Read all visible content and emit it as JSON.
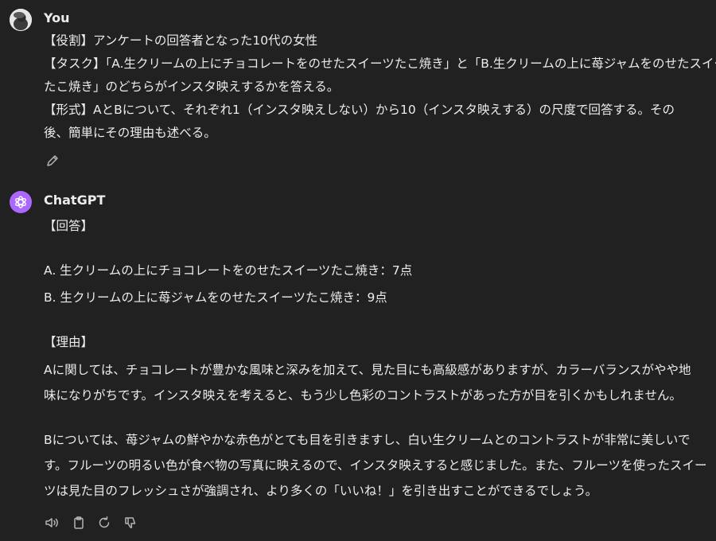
{
  "user": {
    "name": "You",
    "lines": [
      "【役割】アンケートの回答者となった10代の女性",
      "【タスク】「A.生クリームの上にチョコレートをのせたスイーツたこ焼き」と「B.生クリームの上に苺ジャムをのせたスイーツ",
      "たこ焼き」のどちらがインスタ映えするかを答える。",
      "【形式】AとBについて、それぞれ1（インスタ映えしない）から10（インスタ映えする）の尺度で回答する。その",
      "後、簡単にその理由も述べる。"
    ],
    "edit_icon": "pencil-icon"
  },
  "assistant": {
    "name": "ChatGPT",
    "lines": [
      "【回答】",
      "A. 生クリームの上にチョコレートをのせたスイーツたこ焼き：7点",
      "B. 生クリームの上に苺ジャムをのせたスイーツたこ焼き：9点",
      "【理由】",
      "Aに関しては、チョコレートが豊かな風味と深みを加えて、見た目にも高級感がありますが、カラーバランスがやや地",
      "味になりがちです。インスタ映えを考えると、もう少し色彩のコントラストがあった方が目を引くかもしれません。",
      "Bについては、苺ジャムの鮮やかな赤色がとても目を引きますし、白い生クリームとのコントラストが非常に美しいで",
      "す。フルーツの明るい色が食べ物の写真に映えるので、インスタ映えすると感じました。また、フルーツを使ったスイー",
      "ツは見た目のフレッシュさが強調され、より多くの「いいね！」を引き出すことができるでしょう。"
    ],
    "action_icons": [
      "speaker-icon",
      "clipboard-icon",
      "regenerate-icon",
      "thumbs-down-icon"
    ]
  },
  "colors": {
    "background": "#212121",
    "text": "#ececec",
    "gpt_avatar": "#ab68ff",
    "icon": "#b4b4b4"
  }
}
